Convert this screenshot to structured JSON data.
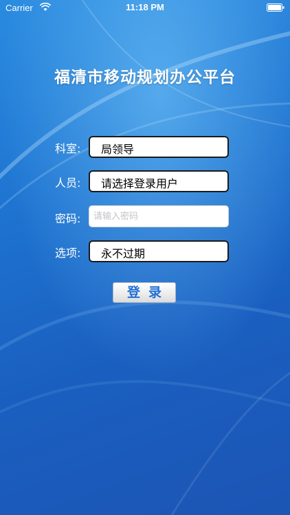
{
  "status_bar": {
    "carrier": "Carrier",
    "time": "11:18 PM",
    "wifi_icon": "wifi-icon",
    "battery_icon": "battery-icon"
  },
  "app": {
    "title": "福清市移动规划办公平台"
  },
  "form": {
    "department": {
      "label": "科室:",
      "value": "局领导"
    },
    "person": {
      "label": "人员:",
      "value": "请选择登录用户"
    },
    "password": {
      "label": "密码:",
      "value": "",
      "placeholder": "请输入密码"
    },
    "option": {
      "label": "选项:",
      "value": "永不过期"
    }
  },
  "login_button": {
    "label": "登录"
  },
  "colors": {
    "background": "#1e6ccb",
    "button_text": "#1f6fd6"
  }
}
